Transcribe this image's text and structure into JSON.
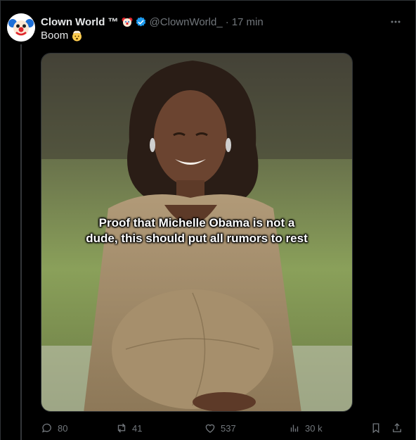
{
  "post": {
    "display_name": "Clown World ™",
    "handle": "@ClownWorld_",
    "separator": "·",
    "timestamp": "17 min",
    "text": "Boom",
    "avatar_icon": "clown-face-icon",
    "verified_icon": "verified-badge-icon",
    "name_emoji": "clown-face-icon",
    "text_emoji": "exploding-head-icon",
    "media_caption": "Proof that Michelle Obama is not a dude, this should put all rumors to rest"
  },
  "actions": {
    "replies": "80",
    "reposts": "41",
    "likes": "537",
    "views": "30 k"
  },
  "colors": {
    "background": "#000000",
    "text_primary": "#e7e9ea",
    "text_secondary": "#71767b",
    "verified": "#1d9bf0",
    "border": "#2f3336"
  }
}
